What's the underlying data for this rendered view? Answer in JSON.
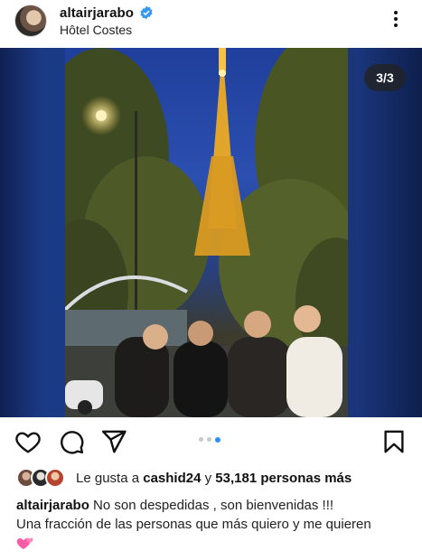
{
  "post": {
    "username": "altairjarabo",
    "location": "Hôtel Costes",
    "carousel_counter": "3/3",
    "carousel": {
      "total": 3,
      "active": 3
    }
  },
  "likes": {
    "prefix": "Le gusta a",
    "first_user": "cashid24",
    "connector": "y",
    "others": "53,181 personas más"
  },
  "caption": {
    "username": "altairjarabo",
    "line1": "No son despedidas , son bienvenidas !!!",
    "line2": "Una fracción de las personas que más quiero y me quieren",
    "emoji": "💕"
  },
  "icons": {
    "like": "heart-icon",
    "comment": "comment-icon",
    "share": "send-icon",
    "save": "bookmark-icon",
    "menu": "more-vertical-icon",
    "verified": "verified-badge-icon"
  },
  "colors": {
    "verified": "#3897f0",
    "active_dot": "#2f8ff5",
    "inactive_dot": "#c9c9c9"
  }
}
